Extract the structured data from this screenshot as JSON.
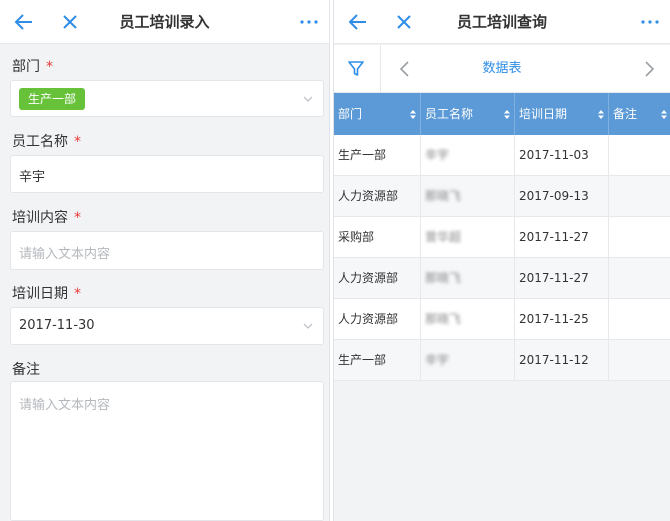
{
  "left": {
    "title": "员工培训录入",
    "fields": [
      {
        "label": "部门",
        "required": "*",
        "tag": "生产一部"
      },
      {
        "label": "员工名称",
        "required": "*",
        "value": "辛宇"
      },
      {
        "label": "培训内容",
        "required": "*",
        "placeholder": "请输入文本内容"
      },
      {
        "label": "培训日期",
        "required": "*",
        "value": "2017-11-30"
      },
      {
        "label": "备注",
        "placeholder": "请输入文本内容"
      }
    ]
  },
  "right": {
    "title": "员工培训查询",
    "view_label": "数据表",
    "columns": [
      "部门",
      "员工名称",
      "培训日期",
      "备注"
    ],
    "rows": [
      {
        "dept": "生产一部",
        "name": "辛宇",
        "date": "2017-11-03",
        "note": ""
      },
      {
        "dept": "人力资源部",
        "name": "那晓飞",
        "date": "2017-09-13",
        "note": ""
      },
      {
        "dept": "采购部",
        "name": "曾华超",
        "date": "2017-11-27",
        "note": ""
      },
      {
        "dept": "人力资源部",
        "name": "那晓飞",
        "date": "2017-11-27",
        "note": ""
      },
      {
        "dept": "人力资源部",
        "name": "那晓飞",
        "date": "2017-11-25",
        "note": ""
      },
      {
        "dept": "生产一部",
        "name": "辛宇",
        "date": "2017-11-12",
        "note": ""
      }
    ]
  },
  "colors": {
    "accent": "#2e8de6",
    "header": "#5b9ad6",
    "tag": "#67c23a",
    "required": "#e53935"
  }
}
